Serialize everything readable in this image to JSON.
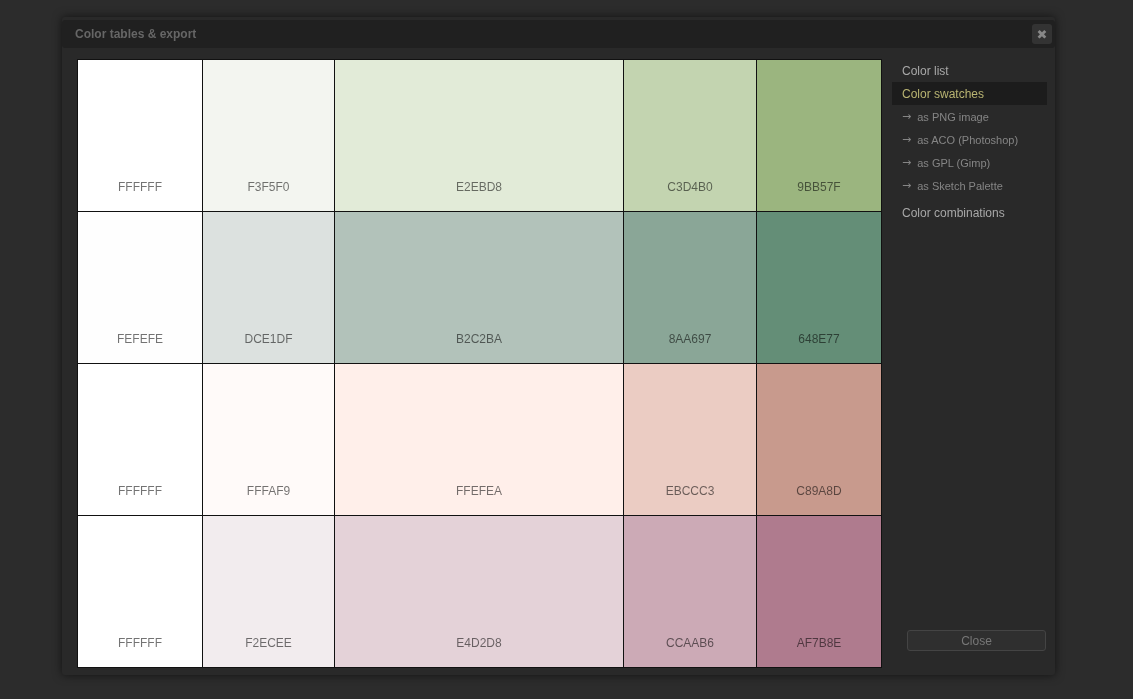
{
  "dialog": {
    "title": "Color tables & export",
    "close_icon": "✖"
  },
  "swatches": [
    [
      {
        "label": "FFFFFF",
        "color": "#ffffff"
      },
      {
        "label": "F3F5F0",
        "color": "#f3f5f0"
      },
      {
        "label": "E2EBD8",
        "color": "#e2ebd8"
      },
      {
        "label": "C3D4B0",
        "color": "#c3d4b0"
      },
      {
        "label": "9BB57F",
        "color": "#9bb57f"
      }
    ],
    [
      {
        "label": "FEFEFE",
        "color": "#fefefe"
      },
      {
        "label": "DCE1DF",
        "color": "#dce1df"
      },
      {
        "label": "B2C2BA",
        "color": "#b2c2ba"
      },
      {
        "label": "8AA697",
        "color": "#8aa697"
      },
      {
        "label": "648E77",
        "color": "#648e77"
      }
    ],
    [
      {
        "label": "FFFFFF",
        "color": "#ffffff"
      },
      {
        "label": "FFFAF9",
        "color": "#fffaf9"
      },
      {
        "label": "FFEFEA",
        "color": "#ffefea"
      },
      {
        "label": "EBCCC3",
        "color": "#ebccc3"
      },
      {
        "label": "C89A8D",
        "color": "#c89a8d"
      }
    ],
    [
      {
        "label": "FFFFFF",
        "color": "#ffffff"
      },
      {
        "label": "F2ECEE",
        "color": "#f2ecee"
      },
      {
        "label": "E4D2D8",
        "color": "#e4d2d8"
      },
      {
        "label": "CCAAB6",
        "color": "#ccaab6"
      },
      {
        "label": "AF7B8E",
        "color": "#af7b8e"
      }
    ]
  ],
  "sidebar": {
    "items": [
      {
        "kind": "section",
        "label": "Color list",
        "selected": false
      },
      {
        "kind": "section",
        "label": "Color swatches",
        "selected": true
      },
      {
        "kind": "export",
        "marker": "→",
        "label": "as PNG image",
        "selected": false
      },
      {
        "kind": "export",
        "marker": "→",
        "label": "as ACO (Photoshop)",
        "selected": false
      },
      {
        "kind": "export",
        "marker": "→",
        "label": "as GPL (Gimp)",
        "selected": false
      },
      {
        "kind": "export",
        "marker": "→",
        "label": "as Sketch Palette",
        "selected": false
      },
      {
        "kind": "section",
        "label": "Color combinations",
        "selected": false
      }
    ]
  },
  "buttons": [
    {
      "label": "Close"
    }
  ]
}
